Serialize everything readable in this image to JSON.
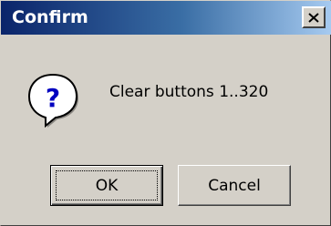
{
  "window": {
    "title": "Confirm",
    "close_icon": "close-icon"
  },
  "dialog": {
    "icon": "question-icon",
    "icon_glyph": "?",
    "message": "Clear buttons 1..320"
  },
  "buttons": {
    "ok_label": "OK",
    "cancel_label": "Cancel"
  },
  "colors": {
    "titlebar_start": "#0a246a",
    "titlebar_end": "#a6caf0",
    "dialog_face": "#d4d0c8",
    "icon_blue": "#0000c0"
  }
}
